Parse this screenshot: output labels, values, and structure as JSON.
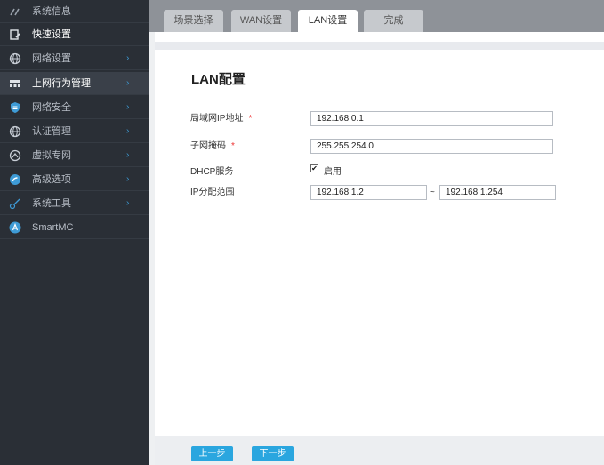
{
  "sidebar": {
    "items": [
      {
        "label": "系统信息",
        "icon": "speedometer-icon",
        "arrow": ""
      },
      {
        "label": "快速设置",
        "icon": "quick-setup-icon",
        "arrow": ""
      },
      {
        "label": "网络设置",
        "icon": "globe-icon",
        "arrow": "›"
      },
      {
        "label": "上网行为管理",
        "icon": "keyboard-icon",
        "arrow": "›"
      },
      {
        "label": "网络安全",
        "icon": "shield-icon",
        "arrow": "›"
      },
      {
        "label": "认证管理",
        "icon": "globe-icon",
        "arrow": "›"
      },
      {
        "label": "虚拟专网",
        "icon": "vpn-globe-icon",
        "arrow": "›"
      },
      {
        "label": "高级选项",
        "icon": "advanced-icon",
        "arrow": "›"
      },
      {
        "label": "系统工具",
        "icon": "tools-icon",
        "arrow": "›"
      },
      {
        "label": "SmartMC",
        "icon": "smartmc-icon",
        "arrow": ""
      }
    ]
  },
  "tabs": [
    {
      "label": "场景选择"
    },
    {
      "label": "WAN设置"
    },
    {
      "label": "LAN设置"
    },
    {
      "label": "完成"
    }
  ],
  "form": {
    "title": "LAN配置",
    "ip_label": "局域网IP地址",
    "ip_value": "192.168.0.1",
    "mask_label": "子网掩码",
    "mask_value": "255.255.254.0",
    "required_mark": "*",
    "dhcp_label": "DHCP服务",
    "dhcp_checkbox_label": "启用",
    "dhcp_checked_mark": "✔",
    "range_label": "IP分配范围",
    "range_start": "192.168.1.2",
    "range_separator": "~",
    "range_end": "192.168.1.254"
  },
  "footer": {
    "prev_label": "上一步",
    "next_label": "下一步"
  },
  "colors": {
    "sidebar_bg": "#2a2f36",
    "accent": "#2aa6df",
    "required": "#e33333"
  }
}
